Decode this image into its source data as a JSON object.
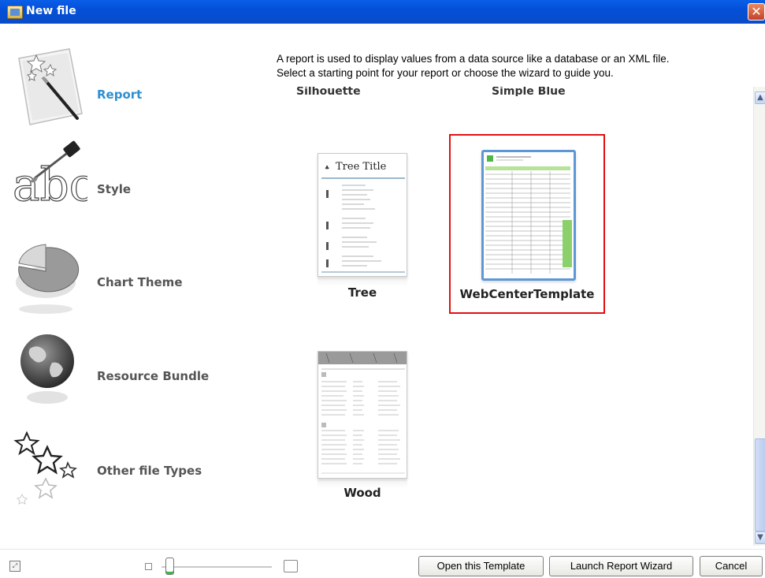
{
  "window": {
    "title": "New file"
  },
  "nav": {
    "items": [
      {
        "label": "Report",
        "icon": "report-icon",
        "selected": true
      },
      {
        "label": "Style",
        "icon": "style-icon",
        "selected": false
      },
      {
        "label": "Chart Theme",
        "icon": "chart-theme-icon",
        "selected": false
      },
      {
        "label": "Resource Bundle",
        "icon": "globe-icon",
        "selected": false
      },
      {
        "label": "Other file Types",
        "icon": "stars-icon",
        "selected": false
      }
    ]
  },
  "description": {
    "line1": "A report is used to display values from a data source like a database or an XML file.",
    "line2": "Select a starting point for your report or choose the wizard to guide you."
  },
  "templates": {
    "cut_labels": [
      "Silhouette Landscape",
      "Simple Blue"
    ],
    "items": [
      {
        "label": "Tree",
        "thumb_title": "Tree Title",
        "selected": false
      },
      {
        "label": "WebCenterTemplate",
        "selected": true
      },
      {
        "label": "Wood",
        "selected": false
      }
    ]
  },
  "buttons": {
    "open": "Open this Template",
    "wizard": "Launch Report Wizard",
    "cancel": "Cancel"
  },
  "colors": {
    "titlebar": "#0350d8",
    "selected_label": "#2f8fd0",
    "selection_border": "#e01010"
  }
}
